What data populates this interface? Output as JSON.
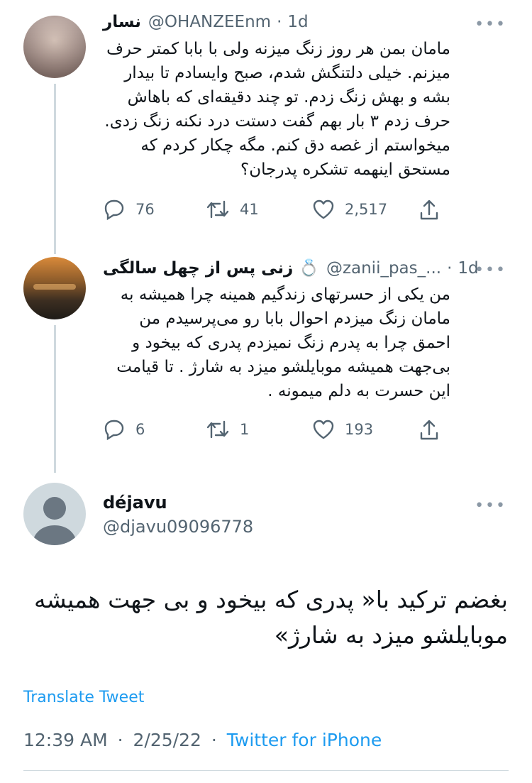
{
  "tweets": [
    {
      "name": "نسار",
      "handle": "@OHANZEEnm",
      "time": "1d",
      "body": "مامان بمن هر روز زنگ میزنه ولی با بابا کمتر حرف میزنم. خیلی دلتنگش شدم، صبح وایسادم تا بیدار بشه و بهش زنگ زدم. تو چند دقیقه‌ای که باهاش حرف زدم ۳ بار بهم گفت دستت درد نکنه زنگ زدی. میخواستم از غصه دق کنم. مگه چکار کردم که مستحق اینهمه تشکره پدرجان؟",
      "replies": "76",
      "retweets": "41",
      "likes": "2,517"
    },
    {
      "name": "زنی پس از چهل سالگی 💍",
      "handle": "@zanii_pas_...",
      "time": "1d",
      "body": "من یکی از حسرتهای زندگیم همینه چرا همیشه به مامان زنگ میزدم احوال بابا رو می‌پرسیدم من احمق چرا به پدرم زنگ نمیزدم پدری که بیخود و بی‌جهت همیشه موبایلشو میزد به شارژ . تا قیامت این حسرت به دلم میمونه .",
      "replies": "6",
      "retweets": "1",
      "likes": "193"
    }
  ],
  "main": {
    "name": "déjavu",
    "handle": "@djavu09096778",
    "body": "بغضم ترکید با« پدری که بیخود و بی جهت همیشه موبایلشو میزد به شارژ»",
    "translate_label": "Translate Tweet",
    "time": "12:39 AM",
    "date": "2/25/22",
    "source": "Twitter for iPhone"
  },
  "separator": "·",
  "more_glyph": "•••",
  "icons": [
    "reply-icon",
    "retweet-icon",
    "like-icon",
    "share-icon",
    "more-icon",
    "default-avatar-icon"
  ],
  "colors": {
    "link": "#1d9bf0",
    "muted": "#536471",
    "text": "#0f1419",
    "line": "#cfd9de"
  }
}
